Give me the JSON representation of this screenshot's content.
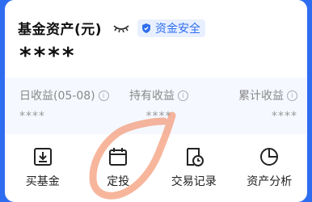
{
  "header": {
    "title": "基金资产(元)",
    "eye_icon": "eye-closed-icon",
    "safety_badge": {
      "icon": "shield-icon",
      "label": "资金安全"
    },
    "asset_value": "****"
  },
  "stats": [
    {
      "label": "日收益(05-08)",
      "value": "****",
      "info_icon": "info-icon"
    },
    {
      "label": "持有收益",
      "value": "****",
      "info_icon": "info-icon"
    },
    {
      "label": "累计收益",
      "value": "****",
      "info_icon": "info-icon"
    }
  ],
  "actions": [
    {
      "label": "买基金",
      "icon": "download-box-icon"
    },
    {
      "label": "定投",
      "icon": "calendar-icon"
    },
    {
      "label": "交易记录",
      "icon": "record-clock-icon"
    },
    {
      "label": "资产分析",
      "icon": "pie-chart-icon"
    }
  ],
  "colors": {
    "accent": "#2f6df0",
    "annotation": "#f07a4a",
    "stats_bg": "#f5f8ff"
  }
}
